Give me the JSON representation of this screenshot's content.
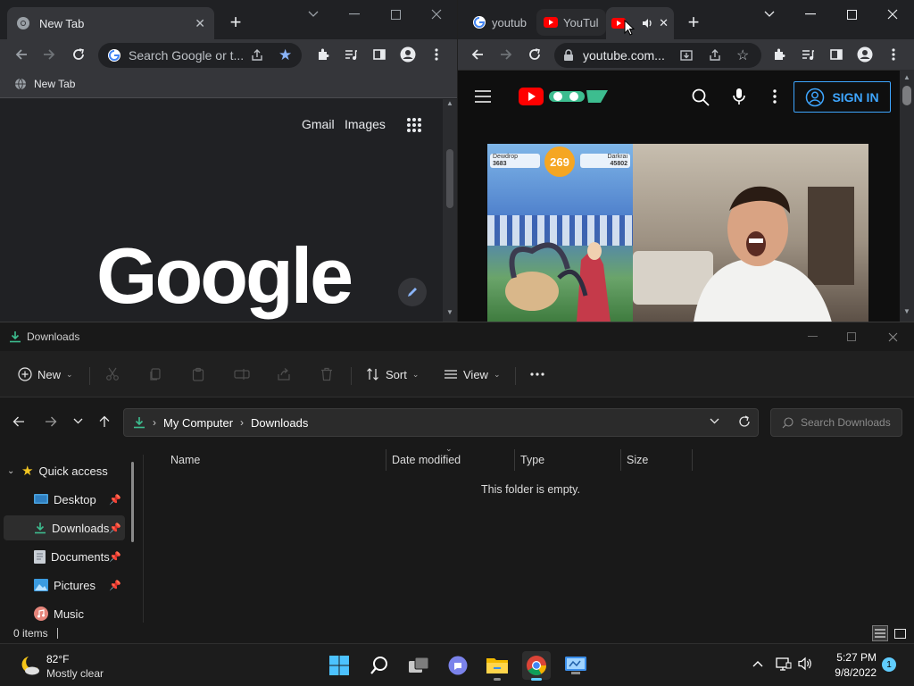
{
  "left_browser": {
    "tab_title": "New Tab",
    "omnibox_placeholder": "Search Google or t...",
    "bookmark": "New Tab",
    "links": {
      "gmail": "Gmail",
      "images": "Images"
    },
    "logo_text": "Google"
  },
  "right_browser": {
    "tabs": [
      {
        "title": "youtub"
      },
      {
        "title": "YouTul"
      },
      {
        "title": ""
      }
    ],
    "url": "youtube.com...",
    "sign_in": "SIGN IN",
    "video_overlay": {
      "score": "269",
      "left_cp": "3683",
      "right_cp": "45802",
      "left_name": "Dewdrop",
      "right_name": "Darkrai"
    }
  },
  "explorer": {
    "title": "Downloads",
    "commands": {
      "new": "New",
      "sort": "Sort",
      "view": "View"
    },
    "breadcrumb": [
      "My Computer",
      "Downloads"
    ],
    "search_placeholder": "Search Downloads",
    "columns": [
      "Name",
      "Date modified",
      "Type",
      "Size"
    ],
    "empty_text": "This folder is empty.",
    "sidebar": [
      {
        "label": "Quick access",
        "pinned": false
      },
      {
        "label": "Desktop",
        "pinned": true
      },
      {
        "label": "Downloads",
        "pinned": true
      },
      {
        "label": "Documents",
        "pinned": true
      },
      {
        "label": "Pictures",
        "pinned": true
      },
      {
        "label": "Music",
        "pinned": false
      }
    ],
    "status": "0 items"
  },
  "taskbar": {
    "weather": {
      "temp": "82°F",
      "condition": "Mostly clear"
    },
    "time": "5:27 PM",
    "date": "9/8/2022",
    "notifications": "1"
  },
  "colors": {
    "accent": "#60cdff",
    "youtube_red": "#ff0000",
    "folder_green": "#3dbd8f"
  }
}
